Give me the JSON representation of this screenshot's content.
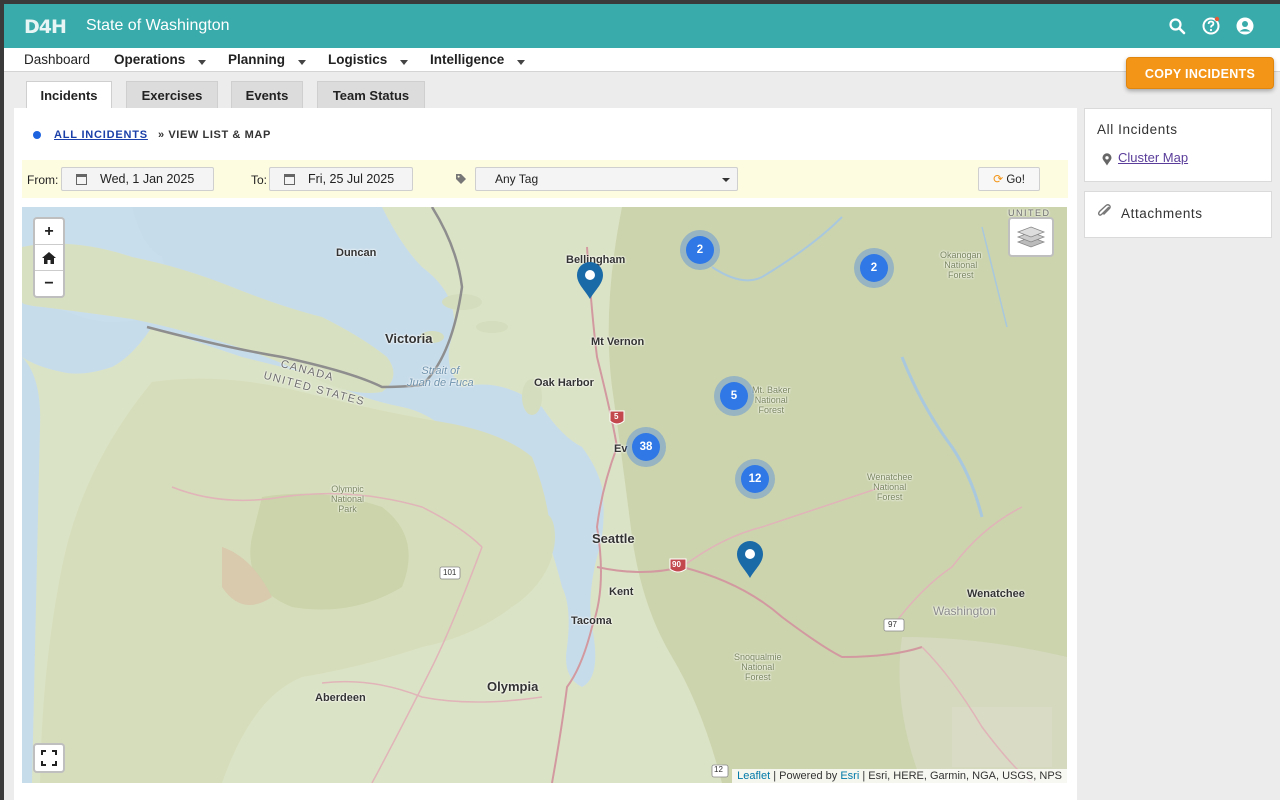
{
  "header": {
    "logo_text": "D4H",
    "title": "State of Washington",
    "icons": [
      "search-icon",
      "help-icon",
      "user-account-icon"
    ]
  },
  "nav": {
    "items": [
      "Dashboard",
      "Operations",
      "Planning",
      "Logistics",
      "Intelligence"
    ]
  },
  "copy_button": "COPY INCIDENTS",
  "tabs": [
    "Incidents",
    "Exercises",
    "Events",
    "Team Status"
  ],
  "active_tab": "Incidents",
  "breadcrumb": {
    "link": "ALL INCIDENTS",
    "separator": "»",
    "current": "VIEW LIST & MAP"
  },
  "filter": {
    "from_label": "From:",
    "from_value": "Wed, 1 Jan 2025",
    "to_label": "To:",
    "to_value": "Fri, 25 Jul 2025",
    "tag_value": "Any Tag",
    "go_label": "Go!"
  },
  "map": {
    "zoom_in": "+",
    "zoom_out": "−",
    "attribution_leaflet": "Leaflet",
    "attribution_powered": "| Powered by",
    "attribution_esri": "Esri",
    "attribution_rest": "| Esri, HERE, Garmin, NGA, USGS, NPS",
    "clusters": [
      "2",
      "2",
      "5",
      "38",
      "12"
    ],
    "places": {
      "duncan": "Duncan",
      "bellingham": "Bellingham",
      "victoria": "Victoria",
      "mt_vernon": "Mt Vernon",
      "oak_harbor": "Oak Harbor",
      "everett": "Ev",
      "seattle": "Seattle",
      "kent": "Kent",
      "tacoma": "Tacoma",
      "olympia": "Olympia",
      "aberdeen": "Aberdeen",
      "wenatchee": "Wenatchee",
      "washington": "Washington",
      "canada": "CANADA",
      "united_states": "UNITED STATES",
      "strait_1": "Strait of",
      "strait_2": "Juan de Fuca",
      "olympic_1": "Olympic",
      "olympic_2": "National",
      "olympic_3": "Park",
      "okanogan_1": "Okanogan",
      "okanogan_2": "National",
      "okanogan_3": "Forest",
      "mtbaker_1": "Mt. Baker",
      "mtbaker_2": "National",
      "mtbaker_3": "Forest",
      "wenatchee_nf_1": "Wenatchee",
      "wenatchee_nf_2": "National",
      "wenatchee_nf_3": "Forest",
      "snoqualmie_1": "Snoqualmie",
      "snoqualmie_2": "National",
      "snoqualmie_3": "Forest",
      "united_corner": "UNITED",
      "i5": "5",
      "i90": "90",
      "us101": "101",
      "us97": "97",
      "us12": "12"
    }
  },
  "sidebar": {
    "all_incidents_title": "All Incidents",
    "cluster_map_link": "Cluster Map",
    "attachments_title": "Attachments"
  },
  "colors": {
    "header": "#3aabab",
    "copy_button": "#f39516",
    "cluster": "#2f78e6",
    "pin": "#1a6aa8",
    "filter_bar": "#fdfbe0"
  }
}
